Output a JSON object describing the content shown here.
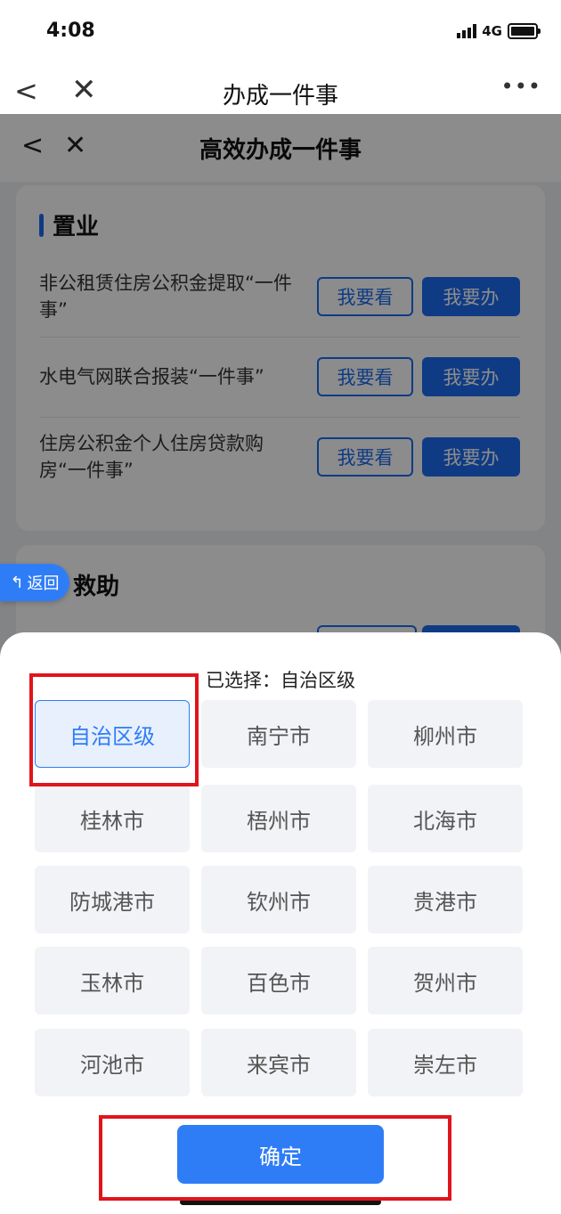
{
  "status": {
    "time": "4:08",
    "network": "4G"
  },
  "nav": {
    "back": "<",
    "close": "✕",
    "title": "办成一件事",
    "more": "•••"
  },
  "page": {
    "inner_title": "高效办成一件事",
    "inner_back": "<",
    "inner_close": "✕",
    "section1": {
      "title": "置业",
      "rows": [
        {
          "text": "非公租赁住房公积金提取“一件事”",
          "view": "我要看",
          "do": "我要办"
        },
        {
          "text": "水电气网联合报装“一件事”",
          "view": "我要看",
          "do": "我要办"
        },
        {
          "text": "住房公积金个人住房贷款购房“一件事”",
          "view": "我要看",
          "do": "我要办"
        }
      ]
    },
    "section2_title": "救助"
  },
  "float_back": {
    "label": "返回"
  },
  "sheet": {
    "selected_label": "已选择：自治区级",
    "regions": [
      "自治区级",
      "南宁市",
      "柳州市",
      "桂林市",
      "梧州市",
      "北海市",
      "防城港市",
      "钦州市",
      "贵港市",
      "玉林市",
      "百色市",
      "贺州市",
      "河池市",
      "来宾市",
      "崇左市"
    ],
    "selected_region": "自治区级",
    "confirm_label": "确定"
  },
  "colors": {
    "accent": "#2f7df6",
    "highlight": "#e1141b"
  }
}
